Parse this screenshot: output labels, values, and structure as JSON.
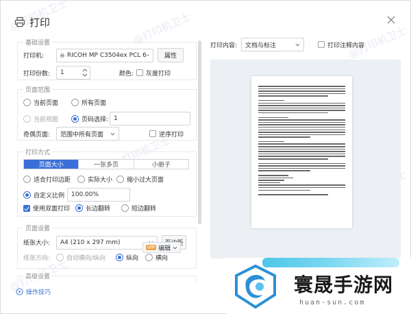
{
  "title": "打印",
  "watermark_text": "@打印机卫士",
  "basic": {
    "section_label": "基础设置",
    "printer_label": "打印机:",
    "printer_value": "RICOH MP C3504ex PCL 6",
    "properties_button": "属性",
    "copies_label": "打印份数:",
    "copies_value": "1",
    "color_label": "颜色:",
    "grayscale_label": "灰度打印",
    "grayscale_checked": false
  },
  "range": {
    "section_label": "页面范围",
    "current_page": "当前页面",
    "all_pages": "所有页面",
    "current_view": "当前视图",
    "page_select": "页码选择:",
    "page_select_value": "1",
    "selected": "page_select",
    "odd_even_label": "奇偶页面:",
    "odd_even_value": "范围中所有页面",
    "reverse_label": "逆序打印",
    "reverse_checked": false
  },
  "mode": {
    "section_label": "打印方式",
    "tabs": [
      "页面大小",
      "一张多页",
      "小册子"
    ],
    "active_tab": 0,
    "fit_margin": "适合打印边距",
    "actual_size": "实际大小",
    "shrink_oversize": "缩小过大页面",
    "custom_scale": "自定义比例",
    "scale_value": "100.00%",
    "scale_selected": "custom_scale",
    "duplex_label": "使用双面打印",
    "duplex_checked": true,
    "long_edge": "长边翻转",
    "short_edge": "短边翻转",
    "flip_selected": "long_edge"
  },
  "page_setup": {
    "section_label": "页面设置",
    "paper_size_label": "纸张大小:",
    "paper_size_value": "A4 (210 x 297 mm)",
    "margins_button": "页边距",
    "orientation_label": "纸张方向:",
    "auto_orientation": "自动横向/纵向",
    "portrait": "纵向",
    "landscape": "横向",
    "orientation_selected": "portrait"
  },
  "advanced_label": "高级设置",
  "tips_link": "操作技巧",
  "preview": {
    "content_label": "打印内容:",
    "content_value": "文档与标注",
    "annotation_label": "打印注释内容",
    "annotation_checked": false,
    "edit_label": "编辑",
    "vip_badge": "VIP"
  },
  "brand": {
    "name": "寰晟手游网",
    "url": "huan-sun.com"
  },
  "colors": {
    "accent": "#3a6fd8",
    "preview_bg": "#eceff3"
  }
}
